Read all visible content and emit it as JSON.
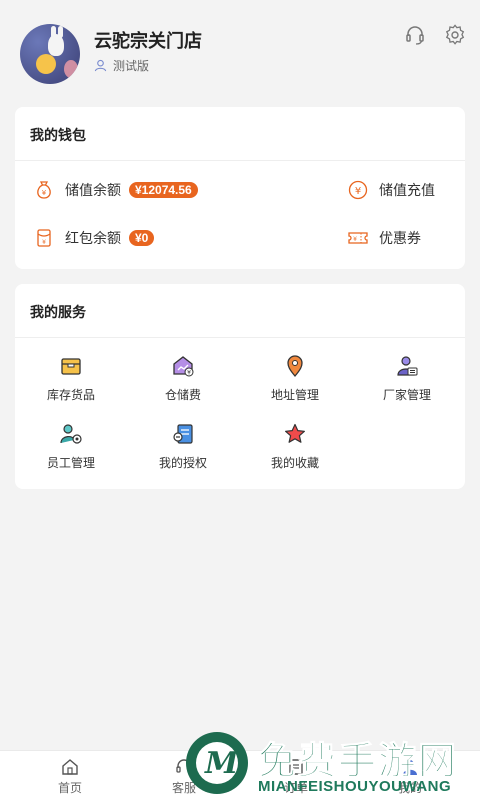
{
  "profile": {
    "store_name": "云驼宗关门店",
    "version_label": "测试版",
    "icons": [
      "headset-icon",
      "gear-icon"
    ]
  },
  "wallet": {
    "title": "我的钱包",
    "items": [
      {
        "label": "储值余额",
        "value": "¥12074.56",
        "icon": "money-bag-icon"
      },
      {
        "label": "储值充值",
        "icon": "yen-circle-icon"
      },
      {
        "label": "红包余额",
        "value": "¥0",
        "icon": "red-envelope-icon"
      },
      {
        "label": "优惠券",
        "icon": "coupon-icon"
      }
    ],
    "accent": "#e8651f"
  },
  "services": {
    "title": "我的服务",
    "items": [
      {
        "label": "库存货品",
        "icon": "box-icon"
      },
      {
        "label": "仓储费",
        "icon": "warehouse-fee-icon"
      },
      {
        "label": "地址管理",
        "icon": "location-pin-icon"
      },
      {
        "label": "厂家管理",
        "icon": "manufacturer-icon"
      },
      {
        "label": "员工管理",
        "icon": "staff-settings-icon"
      },
      {
        "label": "我的授权",
        "icon": "authorization-icon"
      },
      {
        "label": "我的收藏",
        "icon": "star-icon"
      }
    ]
  },
  "tabbar": {
    "items": [
      {
        "label": "首页",
        "icon": "home-icon"
      },
      {
        "label": "客服",
        "icon": "headset-icon"
      },
      {
        "label": "订单",
        "icon": "order-icon"
      },
      {
        "label": "我的",
        "icon": "user-icon"
      }
    ]
  },
  "watermark": {
    "title": "免费手游网",
    "subtitle": "MIANFEISHOUYOUWANG"
  }
}
